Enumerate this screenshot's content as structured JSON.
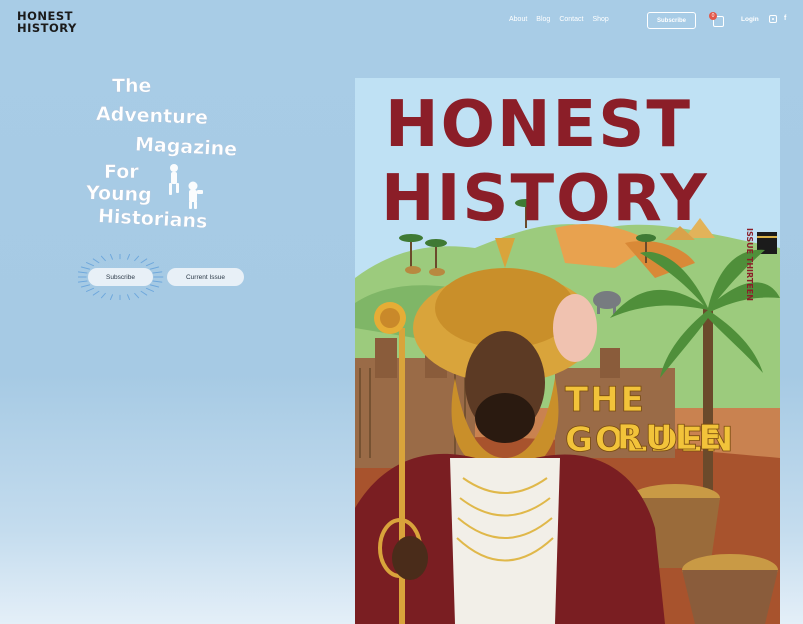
{
  "brand": {
    "line1": "HONEST",
    "line2": "HISTORY"
  },
  "nav": {
    "items": [
      "About",
      "Blog",
      "Contact",
      "Shop"
    ]
  },
  "header": {
    "subscribe_label": "Subscribe",
    "cart_count": "0",
    "login_label": "Login"
  },
  "social": [
    "instagram-icon",
    "facebook-icon"
  ],
  "hero": {
    "tagline": [
      "The",
      "Adventure",
      "Magazine",
      "For",
      "Young",
      "Historians"
    ],
    "subscribe_label": "Subscribe",
    "current_issue_label": "Current Issue"
  },
  "cover": {
    "title_line1": "HONEST",
    "title_line2": "HISTORY",
    "issue_label": "ISSUE THIRTEEN",
    "headline_line1": "THE GOLDEN",
    "headline_line2": "RULE"
  },
  "colors": {
    "background": "#a8cce6",
    "cover_title": "#8b1e28",
    "headline": "#f2c33a"
  }
}
